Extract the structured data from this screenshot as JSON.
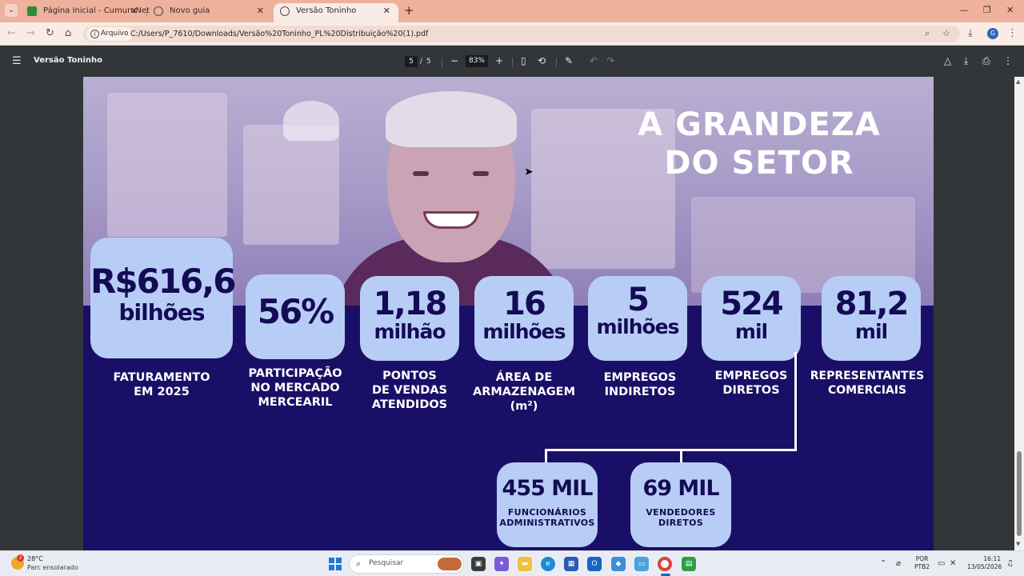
{
  "browser": {
    "tabs": [
      {
        "title": "Página Inicial - CumuruNet",
        "favicon": "cn-favicon-icon",
        "active": false
      },
      {
        "title": "Novo guia",
        "favicon": "globe-icon",
        "active": false
      },
      {
        "title": "Versão Toninho",
        "favicon": "globe-icon",
        "active": true
      }
    ],
    "new_tab_label": "+",
    "address": {
      "chip_label": "Arquivo",
      "url": "C:/Users/P_7610/Downloads/Versão%20Toninho_PL%20Distribuição%20(1).pdf"
    },
    "profile_initial": "G"
  },
  "pdf_viewer": {
    "document_title": "Versão Toninho",
    "current_page": "5",
    "page_separator": "/",
    "total_pages": "5",
    "zoom": "83%"
  },
  "slide": {
    "headline_line1": "A GRANDEZA",
    "headline_line2": "DO SETOR",
    "stats": [
      {
        "value": "R$616,6",
        "unit": "bilhões",
        "label_lines": [
          "FATURAMENTO",
          "EM 2025"
        ]
      },
      {
        "value": "56%",
        "unit": "",
        "label_lines": [
          "PARTICIPAÇÃO",
          "NO MERCADO",
          "MERCEARIL"
        ]
      },
      {
        "value": "1,18",
        "unit": "milhão",
        "label_lines": [
          "PONTOS",
          "DE VENDAS",
          "ATENDIDOS"
        ]
      },
      {
        "value": "16",
        "unit": "milhões",
        "label_lines": [
          "ÁREA DE",
          "ARMAZENAGEM",
          "(m²)"
        ]
      },
      {
        "value": "5",
        "unit": "milhões",
        "label_lines": [
          "EMPREGOS",
          "INDIRETOS"
        ]
      },
      {
        "value": "524",
        "unit": "mil",
        "label_lines": [
          "EMPREGOS",
          "DIRETOS"
        ]
      },
      {
        "value": "81,2",
        "unit": "mil",
        "label_lines": [
          "REPRESENTANTES",
          "COMERCIAIS"
        ]
      }
    ],
    "breakdown": [
      {
        "value": "455 MIL",
        "label_lines": [
          "FUNCIONÁRIOS",
          "ADMINISTRATIVOS"
        ]
      },
      {
        "value": "69 MIL",
        "label_lines": [
          "VENDEDORES",
          "DIRETOS"
        ]
      }
    ],
    "colors": {
      "navy": "#1a0f66",
      "card": "#b8cdf6",
      "card_text": "#140b55"
    }
  },
  "taskbar": {
    "temperature": "28°C",
    "weather_condition": "Parc ensolarado",
    "weather_badge": "2",
    "search_placeholder": "Pesquisar",
    "language_line1": "POR",
    "language_line2": "PTB2",
    "time": "16:11",
    "date": "13/05/2026"
  }
}
